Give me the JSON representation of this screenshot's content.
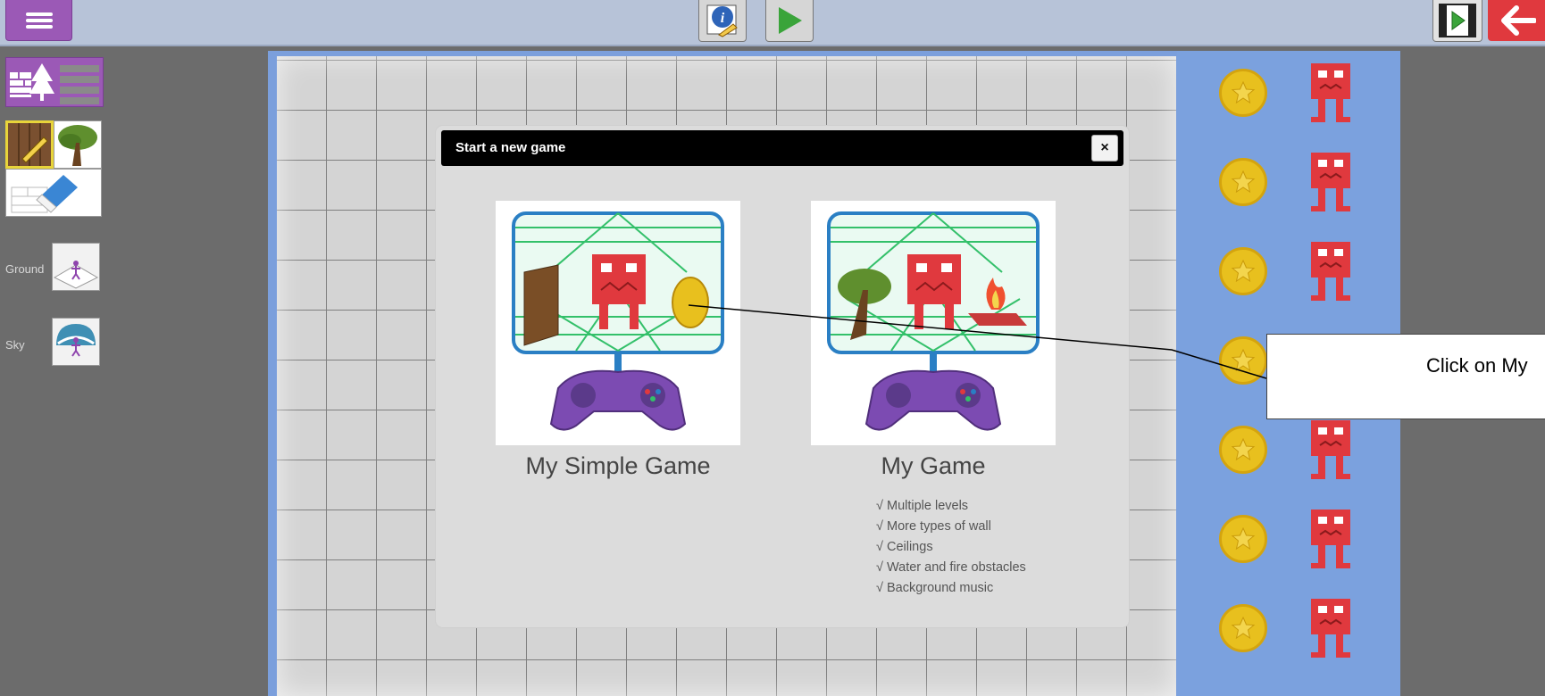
{
  "toolbar": {
    "menu_icon": "hamburger-icon",
    "info_icon": "info-edit-icon",
    "play_icon": "play-icon",
    "film_icon": "film-play-icon",
    "back_icon": "back-arrow-icon"
  },
  "sidebar": {
    "ground_label": "Ground",
    "sky_label": "Sky"
  },
  "dialog": {
    "title": "Start a new game",
    "close_label": "×",
    "options": [
      {
        "title": "My Simple Game"
      },
      {
        "title": "My Game"
      }
    ],
    "features": [
      "√ Multiple levels",
      "√ More types of wall",
      "√ Ceilings",
      "√ Water and fire obstacles",
      "√ Background music"
    ]
  },
  "callout": {
    "text": "Click on My"
  },
  "colors": {
    "accent_purple": "#9b59b6",
    "play_green": "#3aa43a",
    "back_red": "#e0393e",
    "palette_blue": "#7ba1de"
  }
}
